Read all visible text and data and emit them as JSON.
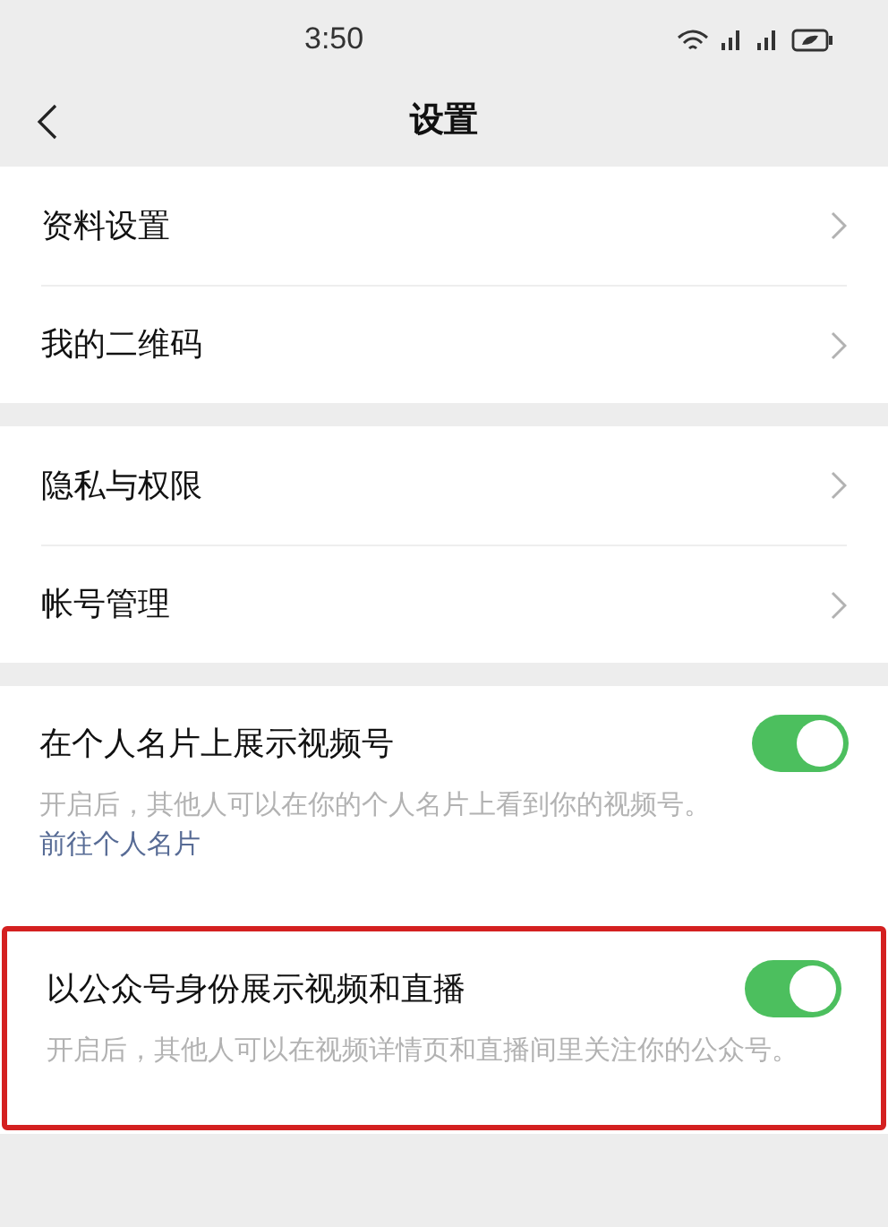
{
  "status_bar": {
    "time": "3:50"
  },
  "nav": {
    "title": "设置"
  },
  "groups": [
    [
      {
        "label": "资料设置"
      },
      {
        "label": "我的二维码"
      }
    ],
    [
      {
        "label": "隐私与权限"
      },
      {
        "label": "帐号管理"
      }
    ]
  ],
  "toggles": [
    {
      "label": "在个人名片上展示视频号",
      "on": true,
      "highlighted": false,
      "description": "开启后，其他人可以在你的个人名片上看到你的视频号。",
      "link": "前往个人名片"
    },
    {
      "label": "以公众号身份展示视频和直播",
      "on": true,
      "highlighted": true,
      "description": "开启后，其他人可以在视频详情页和直播间里关注你的公众号。"
    }
  ]
}
